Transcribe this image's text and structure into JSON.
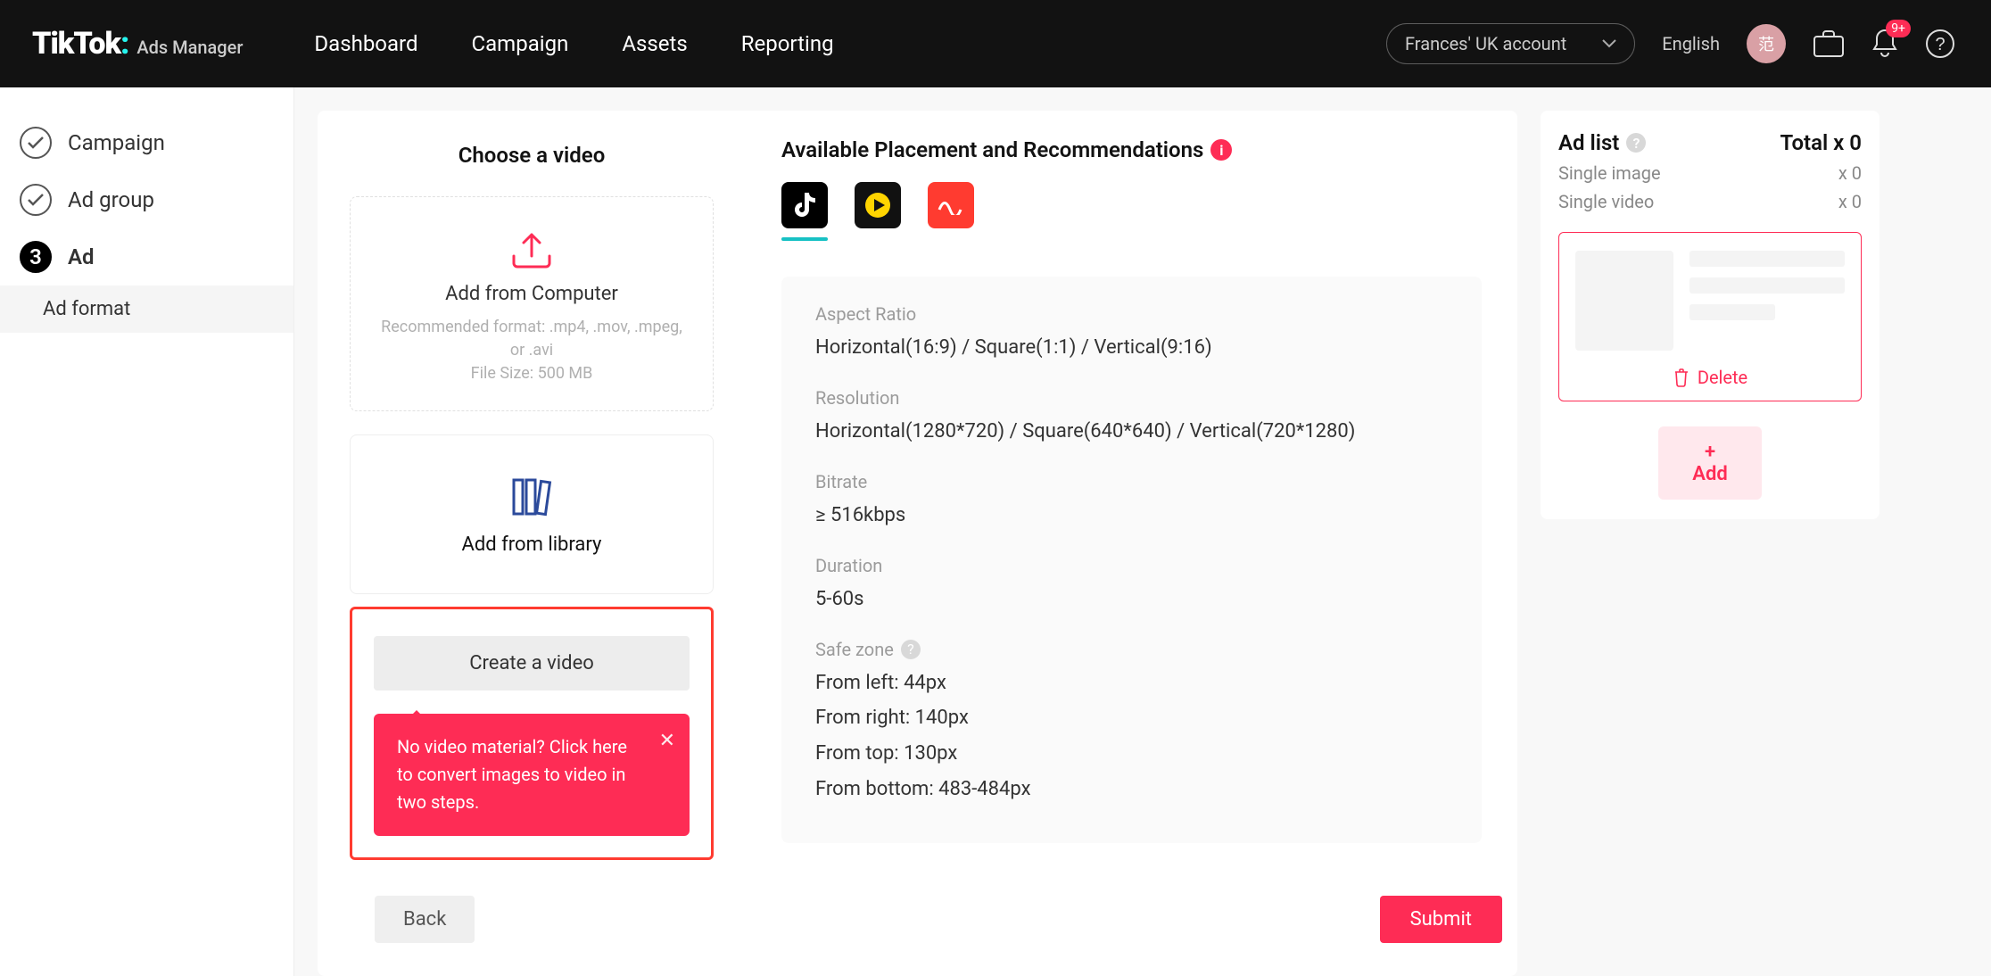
{
  "topbar": {
    "brand_main": "TikTok",
    "brand_sub": "Ads Manager",
    "nav": {
      "dashboard": "Dashboard",
      "campaign": "Campaign",
      "assets": "Assets",
      "reporting": "Reporting"
    },
    "account_name": "Frances' UK account",
    "language": "English",
    "avatar_initial": "范",
    "notif_badge": "9+"
  },
  "sidebar": {
    "step1": "Campaign",
    "step2": "Ad group",
    "step3_num": "3",
    "step3": "Ad",
    "substep": "Ad format"
  },
  "choose": {
    "heading": "Choose a video",
    "upload_title": "Add from Computer",
    "upload_hint1": "Recommended format: .mp4, .mov, .mpeg, or .avi",
    "upload_hint2": "File Size: 500 MB",
    "library_title": "Add from library",
    "create_label": "Create a video",
    "tooltip_text": "No video material? Click here to convert images to video in two steps."
  },
  "placements": {
    "title": "Available Placement and Recommendations",
    "specs": {
      "aspect_label": "Aspect Ratio",
      "aspect_value": "Horizontal(16:9) / Square(1:1) / Vertical(9:16)",
      "res_label": "Resolution",
      "res_value": "Horizontal(1280*720) / Square(640*640) / Vertical(720*1280)",
      "bitrate_label": "Bitrate",
      "bitrate_value": "≥ 516kbps",
      "duration_label": "Duration",
      "duration_value": "5-60s",
      "safe_label": "Safe zone",
      "safe_left": "From left: 44px",
      "safe_right": "From right: 140px",
      "safe_top": "From top: 130px",
      "safe_bottom": "From bottom: 483-484px"
    }
  },
  "footer": {
    "back": "Back",
    "submit": "Submit"
  },
  "adlist": {
    "heading": "Ad list",
    "total": "Total x 0",
    "single_image_label": "Single image",
    "single_image_count": "x 0",
    "single_video_label": "Single video",
    "single_video_count": "x 0",
    "delete_label": "Delete",
    "add_label": "+ Add"
  }
}
